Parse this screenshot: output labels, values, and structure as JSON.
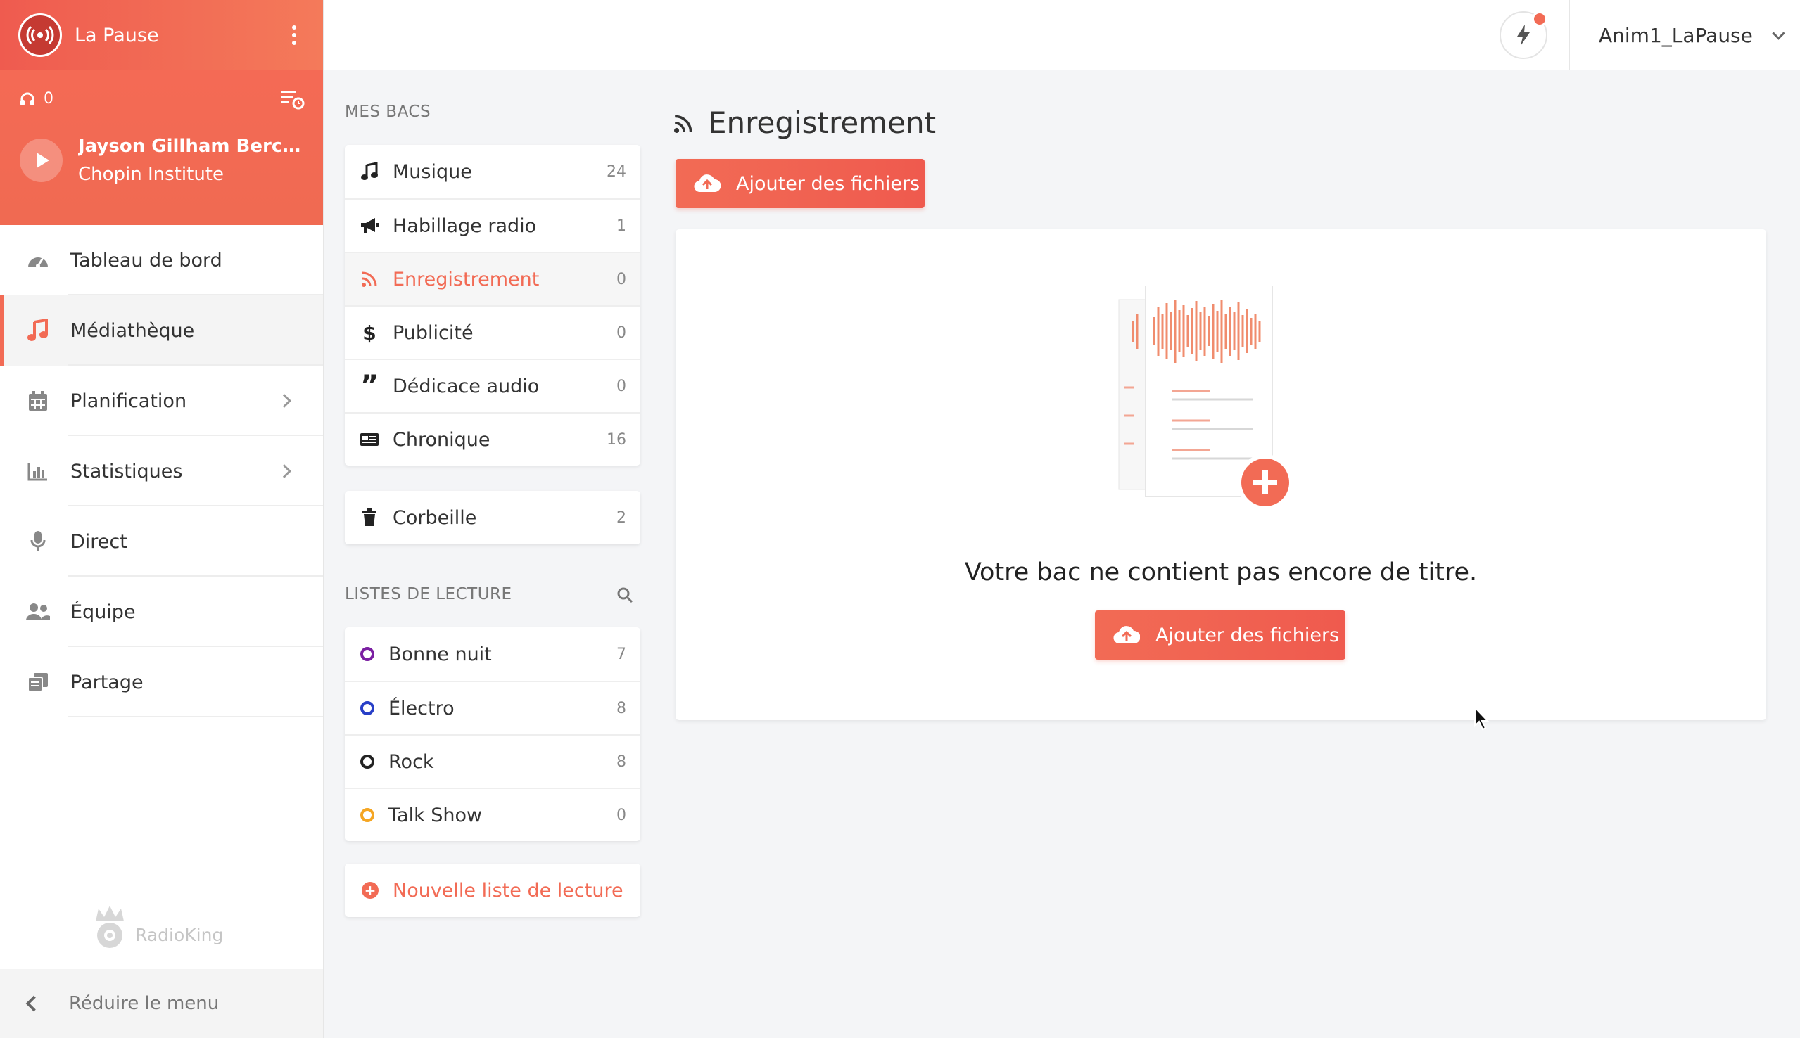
{
  "station": {
    "name": "La Pause"
  },
  "player": {
    "listeners": "0",
    "track_title": "Jayson Gillham Berceus...",
    "artist": "Chopin Institute"
  },
  "nav": {
    "items": [
      {
        "label": "Tableau de bord",
        "icon": "gauge-icon"
      },
      {
        "label": "Médiathèque",
        "icon": "music-note-icon",
        "active": true
      },
      {
        "label": "Planification",
        "icon": "calendar-icon",
        "has_submenu": true
      },
      {
        "label": "Statistiques",
        "icon": "bar-chart-icon",
        "has_submenu": true
      },
      {
        "label": "Direct",
        "icon": "microphone-icon"
      },
      {
        "label": "Équipe",
        "icon": "users-icon"
      },
      {
        "label": "Partage",
        "icon": "share-icon"
      }
    ],
    "collapse_label": "Réduire le menu"
  },
  "brand": {
    "text": "RadioKing"
  },
  "topbar": {
    "user": "Anim1_LaPause"
  },
  "bacs": {
    "section_label": "MES BACS",
    "items": [
      {
        "label": "Musique",
        "count": "24",
        "icon": "music-note-icon"
      },
      {
        "label": "Habillage radio",
        "count": "1",
        "icon": "megaphone-icon"
      },
      {
        "label": "Enregistrement",
        "count": "0",
        "icon": "rss-icon",
        "active": true
      },
      {
        "label": "Publicité",
        "count": "0",
        "icon": "dollar-icon"
      },
      {
        "label": "Dédicace audio",
        "count": "0",
        "icon": "quote-icon"
      },
      {
        "label": "Chronique",
        "count": "16",
        "icon": "newspaper-icon"
      }
    ],
    "trash": {
      "label": "Corbeille",
      "count": "2",
      "icon": "trash-icon"
    }
  },
  "playlists": {
    "section_label": "LISTES DE LECTURE",
    "items": [
      {
        "label": "Bonne nuit",
        "count": "7",
        "color": "#7b1fa2"
      },
      {
        "label": "Électro",
        "count": "8",
        "color": "#283fc7"
      },
      {
        "label": "Rock",
        "count": "8",
        "color": "#222222"
      },
      {
        "label": "Talk Show",
        "count": "0",
        "color": "#f5a623"
      }
    ],
    "new_label": "Nouvelle liste de lecture"
  },
  "main": {
    "title": "Enregistrement",
    "add_files_label": "Ajouter des fichiers",
    "empty_text": "Votre bac ne contient pas encore de titre."
  },
  "colors": {
    "accent": "#f26b55",
    "accent_dark": "#ef5a4e"
  }
}
